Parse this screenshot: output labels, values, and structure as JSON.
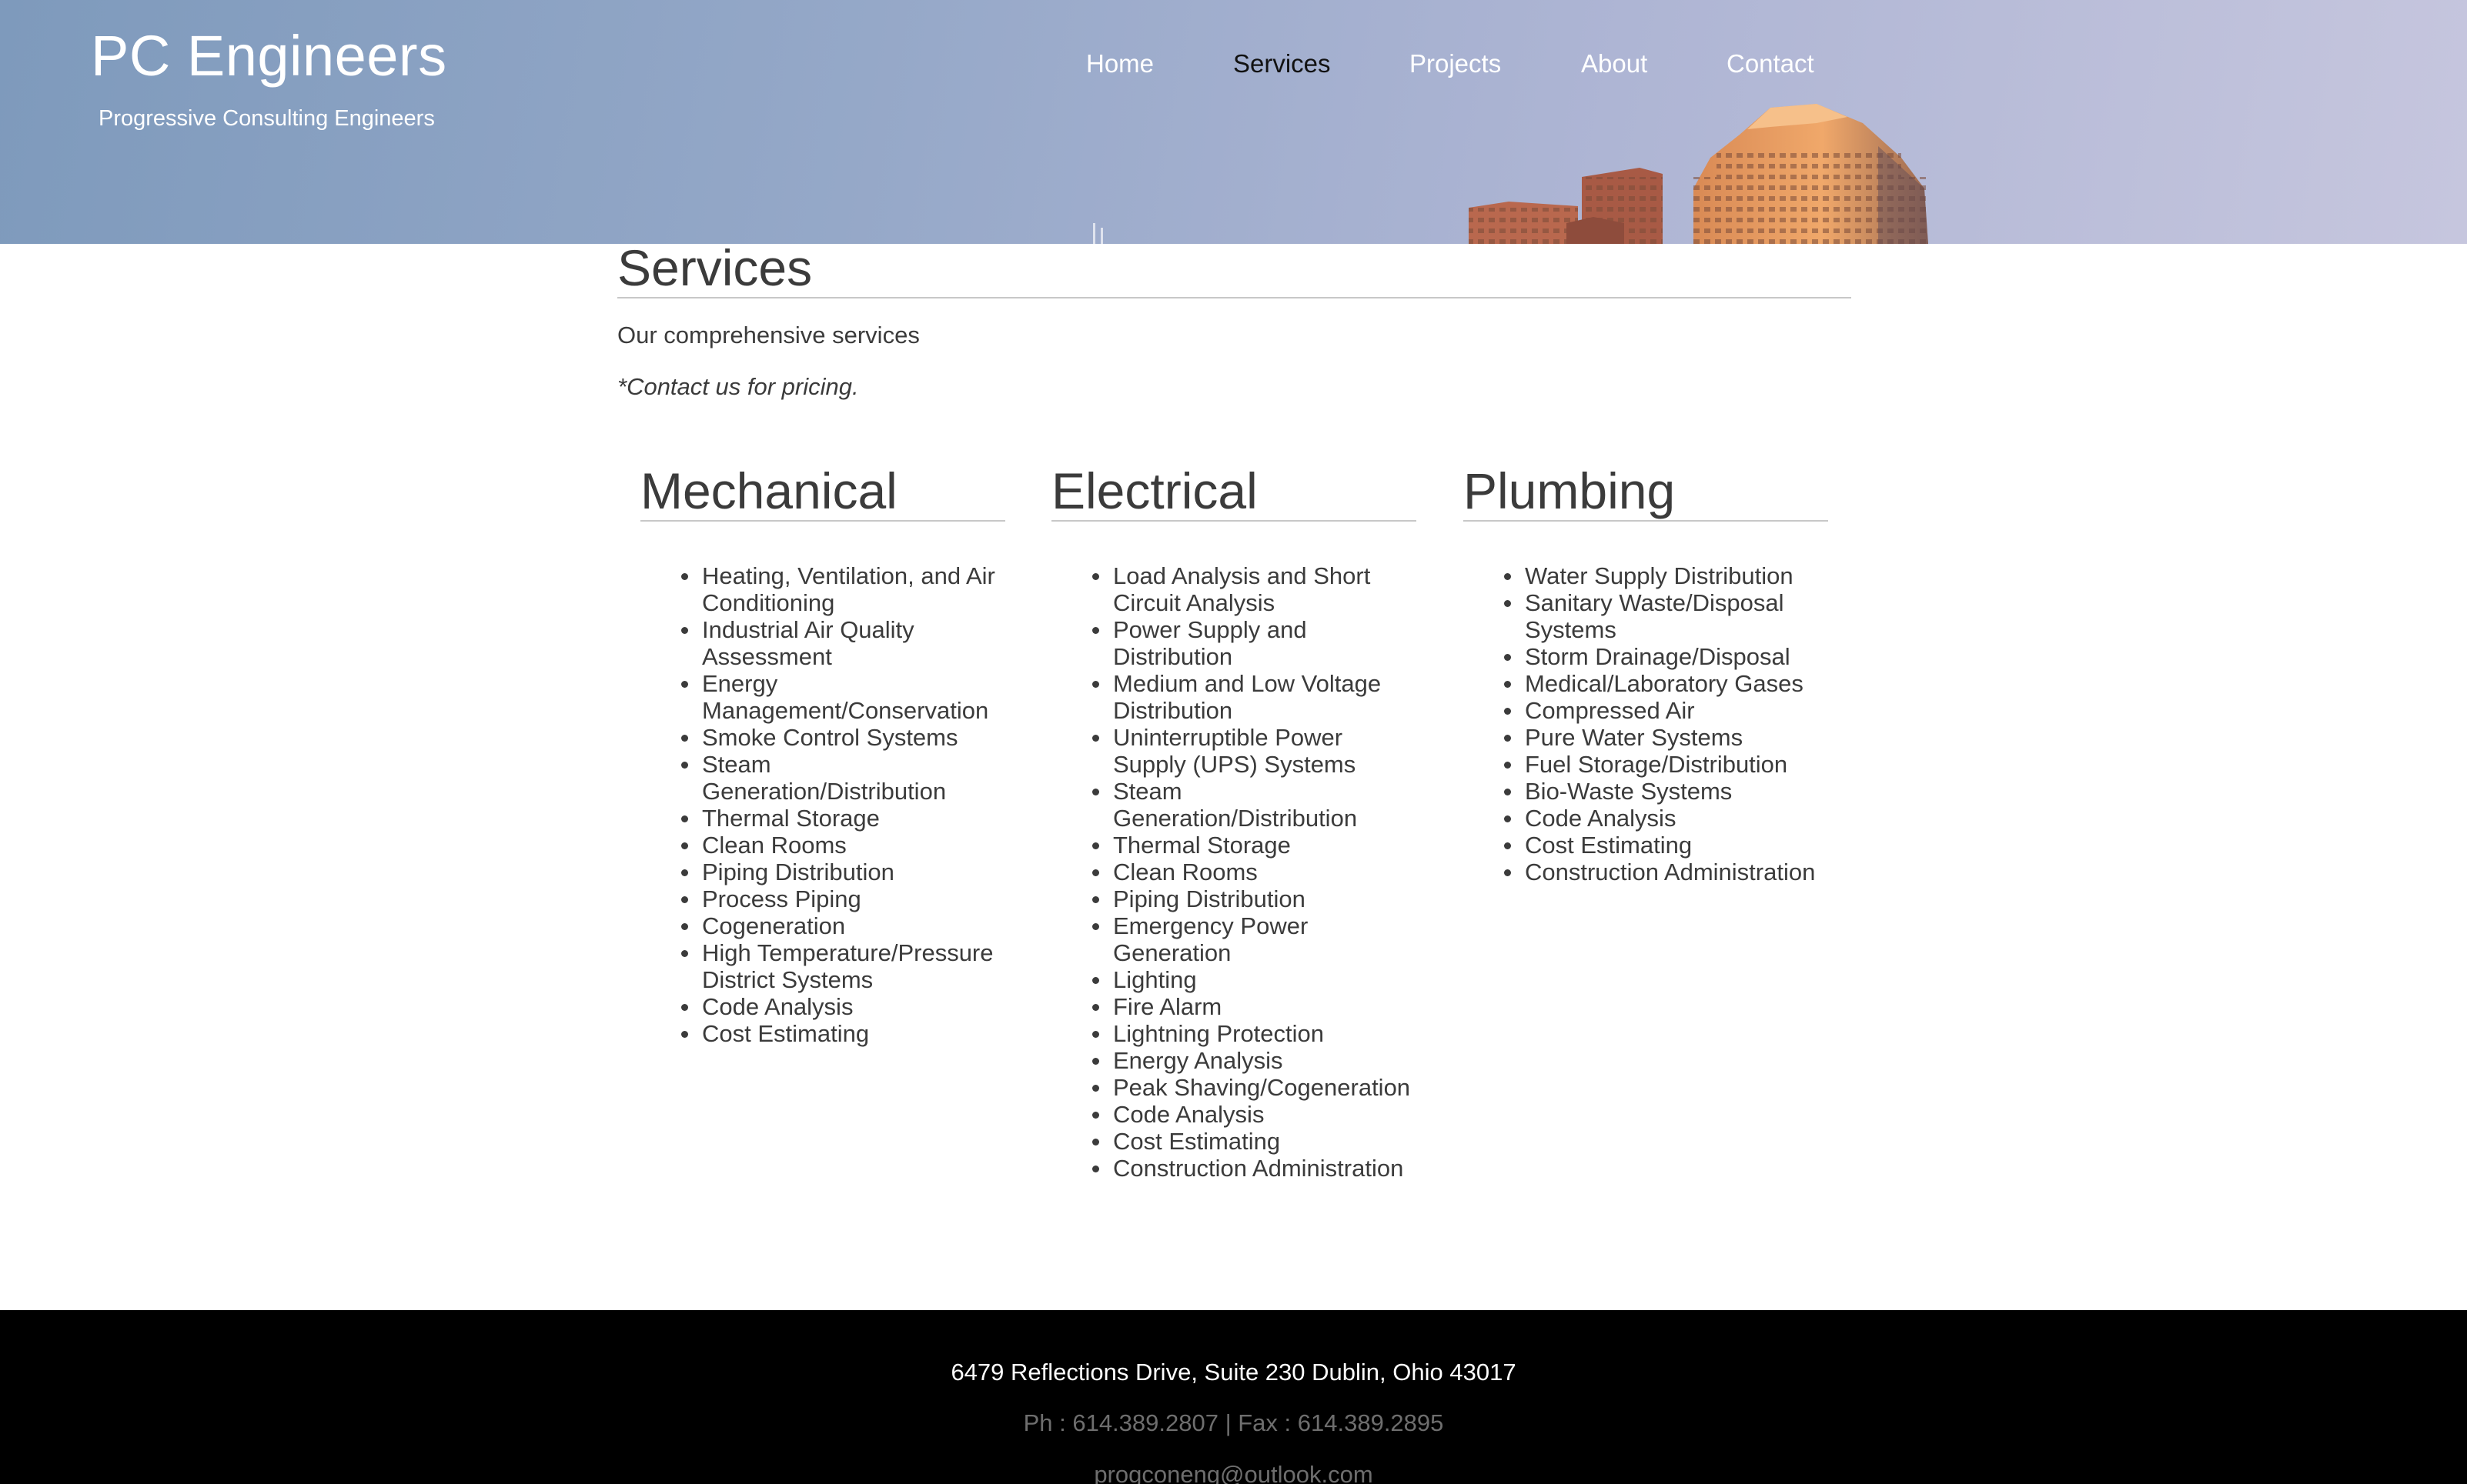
{
  "header": {
    "brand_title": "PC Engineers",
    "brand_tagline": "Progressive Consulting Engineers",
    "nav": [
      {
        "label": "Home",
        "active": false
      },
      {
        "label": "Services",
        "active": true
      },
      {
        "label": "Projects",
        "active": false
      },
      {
        "label": "About",
        "active": false
      },
      {
        "label": "Contact",
        "active": false
      }
    ]
  },
  "main": {
    "title": "Services",
    "intro": "Our comprehensive services",
    "note": "*Contact us for pricing.",
    "columns": [
      {
        "title": "Mechanical",
        "items": [
          "Heating, Ventilation, and Air Conditioning",
          "Industrial Air Quality Assessment",
          "Energy Management/Conservation",
          "Smoke Control Systems",
          "Steam Generation/Distribution",
          "Thermal Storage",
          "Clean Rooms",
          "Piping Distribution",
          "Process Piping",
          "Cogeneration",
          "High Temperature/Pressure District Systems",
          "Code Analysis",
          "Cost Estimating"
        ]
      },
      {
        "title": "Electrical",
        "items": [
          "Load Analysis and Short Circuit Analysis",
          "Power Supply and Distribution",
          "Medium and Low Voltage Distribution",
          "Uninterruptible Power Supply (UPS) Systems",
          "Steam Generation/Distribution",
          "Thermal Storage",
          "Clean Rooms",
          "Piping Distribution",
          "Emergency Power Generation",
          "Lighting",
          "Fire Alarm",
          "Lightning Protection",
          "Energy Analysis",
          "Peak Shaving/Cogeneration",
          "Code Analysis",
          "Cost Estimating",
          "Construction Administration"
        ]
      },
      {
        "title": "Plumbing",
        "items": [
          "Water Supply Distribution",
          "Sanitary Waste/Disposal Systems",
          "Storm Drainage/Disposal",
          "Medical/Laboratory Gases",
          "Compressed Air",
          "Pure Water Systems",
          "Fuel Storage/Distribution",
          "Bio-Waste Systems",
          "Code Analysis",
          "Cost Estimating",
          "Construction Administration"
        ]
      }
    ]
  },
  "footer": {
    "address": "6479 Reflections Drive, Suite 230 Dublin, Ohio 43017",
    "phone_fax": "Ph : 614.389.2807 | Fax : 614.389.2895",
    "email": "progconeng@outlook.com"
  }
}
